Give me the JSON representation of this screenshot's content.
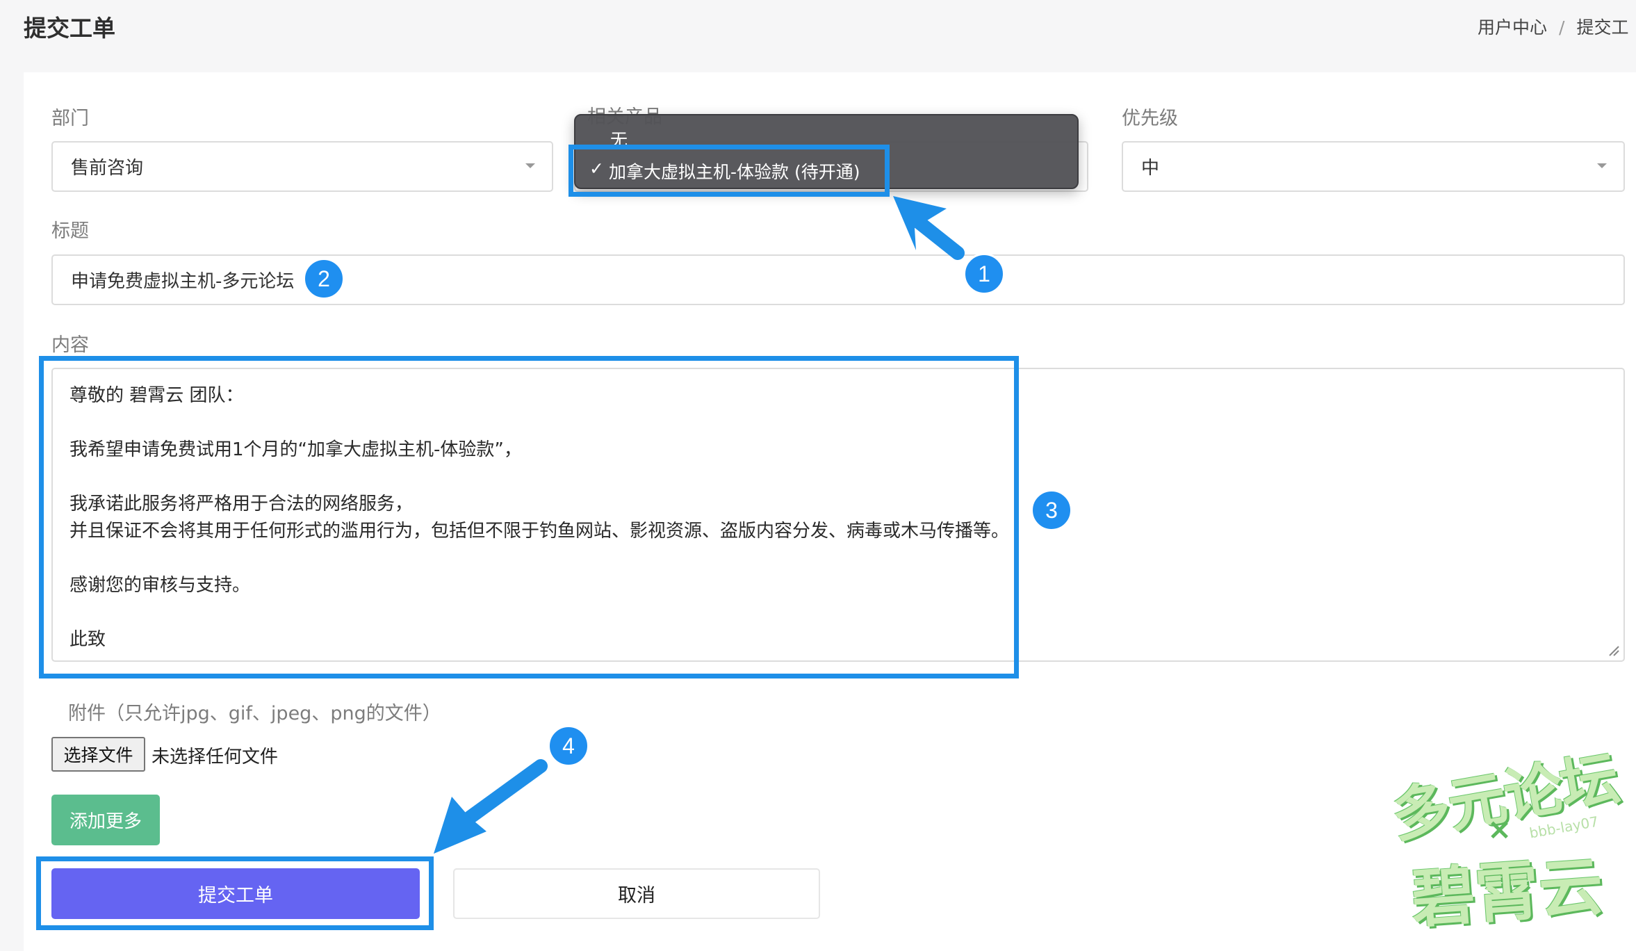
{
  "header": {
    "title": "提交工单",
    "breadcrumb": [
      "用户中心",
      "/",
      "提交工"
    ]
  },
  "form": {
    "department": {
      "label": "部门",
      "value": "售前咨询"
    },
    "product": {
      "label": "相关产品",
      "options": [
        "无",
        "加拿大虚拟主机-体验款 (待开通)"
      ],
      "selected": "加拿大虚拟主机-体验款 (待开通)",
      "check": "✓"
    },
    "priority": {
      "label": "优先级",
      "value": "中"
    },
    "title": {
      "label": "标题",
      "value": "申请免费虚拟主机-多元论坛"
    },
    "content": {
      "label": "内容",
      "lines": [
        "尊敬的 碧霄云 团队：",
        "我希望申请免费试用1个月的“加拿大虚拟主机-体验款”，",
        "我承诺此服务将严格用于合法的网络服务，",
        "并且保证不会将其用于任何形式的滥用行为，包括但不限于钓鱼网站、影视资源、盗版内容分发、病毒或木马传播等。",
        "感谢您的审核与支持。",
        "此致"
      ]
    },
    "attachment": {
      "label": "附件（只允许jpg、gif、jpeg、png的文件）",
      "button": "选择文件",
      "status": "未选择任何文件"
    },
    "add_more": "添加更多",
    "submit": "提交工单",
    "cancel": "取消"
  },
  "annotations": {
    "badges": [
      "1",
      "2",
      "3",
      "4"
    ],
    "color": "#1e8fe8"
  },
  "watermark": {
    "line1": "多元论坛",
    "cross": "×",
    "line2": "碧霄云",
    "small": "bbb-lay07"
  },
  "colors": {
    "submit": "#6564f2",
    "add_more": "#5bbd8e",
    "popup": "#525256"
  }
}
